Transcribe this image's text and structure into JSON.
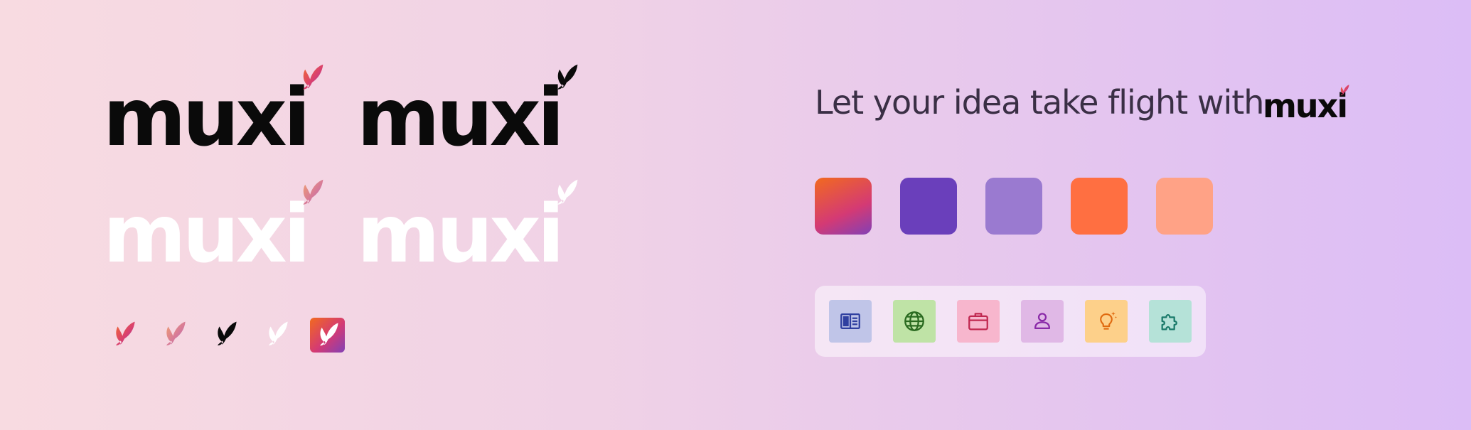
{
  "logos": {
    "wordmark": "muxi",
    "variants": [
      {
        "name": "black-wordmark-gradient-bird",
        "text_color": "#0a0a0a",
        "bird": "gradient-bird"
      },
      {
        "name": "black-wordmark-black-bird",
        "text_color": "#0a0a0a",
        "bird": "black-bird"
      },
      {
        "name": "white-wordmark-gradient-bird",
        "text_color": "#ffffff",
        "bird": "muted-gradient-bird"
      },
      {
        "name": "white-wordmark-white-bird",
        "text_color": "#ffffff",
        "bird": "white-bird"
      }
    ]
  },
  "marks": [
    "gradient-bird",
    "muted-gradient-bird",
    "black-bird",
    "white-bird",
    "app-icon-bird"
  ],
  "tagline": {
    "text": "Let your idea take flight with",
    "brand": "muxi"
  },
  "palette": [
    {
      "name": "brand-gradient",
      "colors": [
        "#f05a28",
        "#d23c78",
        "#8b3fb0"
      ]
    },
    {
      "name": "deep-purple",
      "color": "#6a3fbb"
    },
    {
      "name": "lavender",
      "color": "#9a7ad0"
    },
    {
      "name": "orange",
      "color": "#ff6f41"
    },
    {
      "name": "peach",
      "color": "#ffa286"
    }
  ],
  "icon_tiles": [
    {
      "icon": "book-open-icon",
      "bg": "#c0c5e8",
      "fg": "#3040a0"
    },
    {
      "icon": "globe-icon",
      "bg": "#bfe3a6",
      "fg": "#2a6a20"
    },
    {
      "icon": "briefcase-icon",
      "bg": "#f7b6cd",
      "fg": "#c02850"
    },
    {
      "icon": "user-icon",
      "bg": "#e0b8e6",
      "fg": "#8a2aa8"
    },
    {
      "icon": "lightbulb-icon",
      "bg": "#fdd08a",
      "fg": "#e06a10"
    },
    {
      "icon": "puzzle-icon",
      "bg": "#b5e2d8",
      "fg": "#1a7a6a"
    }
  ]
}
